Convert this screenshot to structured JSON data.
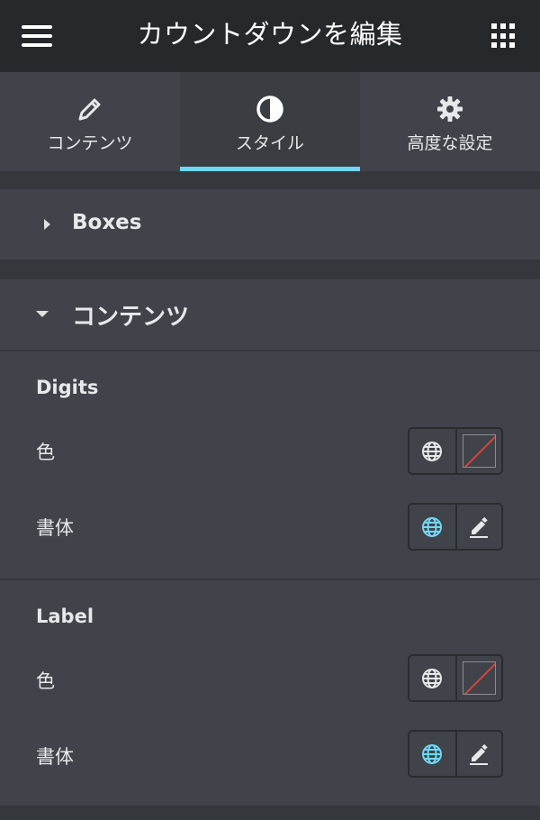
{
  "header": {
    "title": "カウントダウンを編集",
    "menu_icon": "hamburger-icon",
    "apps_icon": "grid-icon"
  },
  "tabs": [
    {
      "label": "コンテンツ",
      "icon": "pencil-icon",
      "active": false
    },
    {
      "label": "スタイル",
      "icon": "contrast-icon",
      "active": true
    },
    {
      "label": "高度な設定",
      "icon": "gear-icon",
      "active": false
    }
  ],
  "sections": {
    "boxes": {
      "title": "Boxes",
      "expanded": false
    },
    "content": {
      "title": "コンテンツ",
      "expanded": true
    }
  },
  "digits": {
    "heading": "Digits",
    "color_label": "色",
    "typography_label": "書体"
  },
  "label": {
    "heading": "Label",
    "color_label": "色",
    "typography_label": "書体"
  },
  "colors": {
    "accent": "#71d7f7",
    "header_bg": "#26292c",
    "panel_bg": "#404349",
    "unset_slash": "#d9443c"
  }
}
